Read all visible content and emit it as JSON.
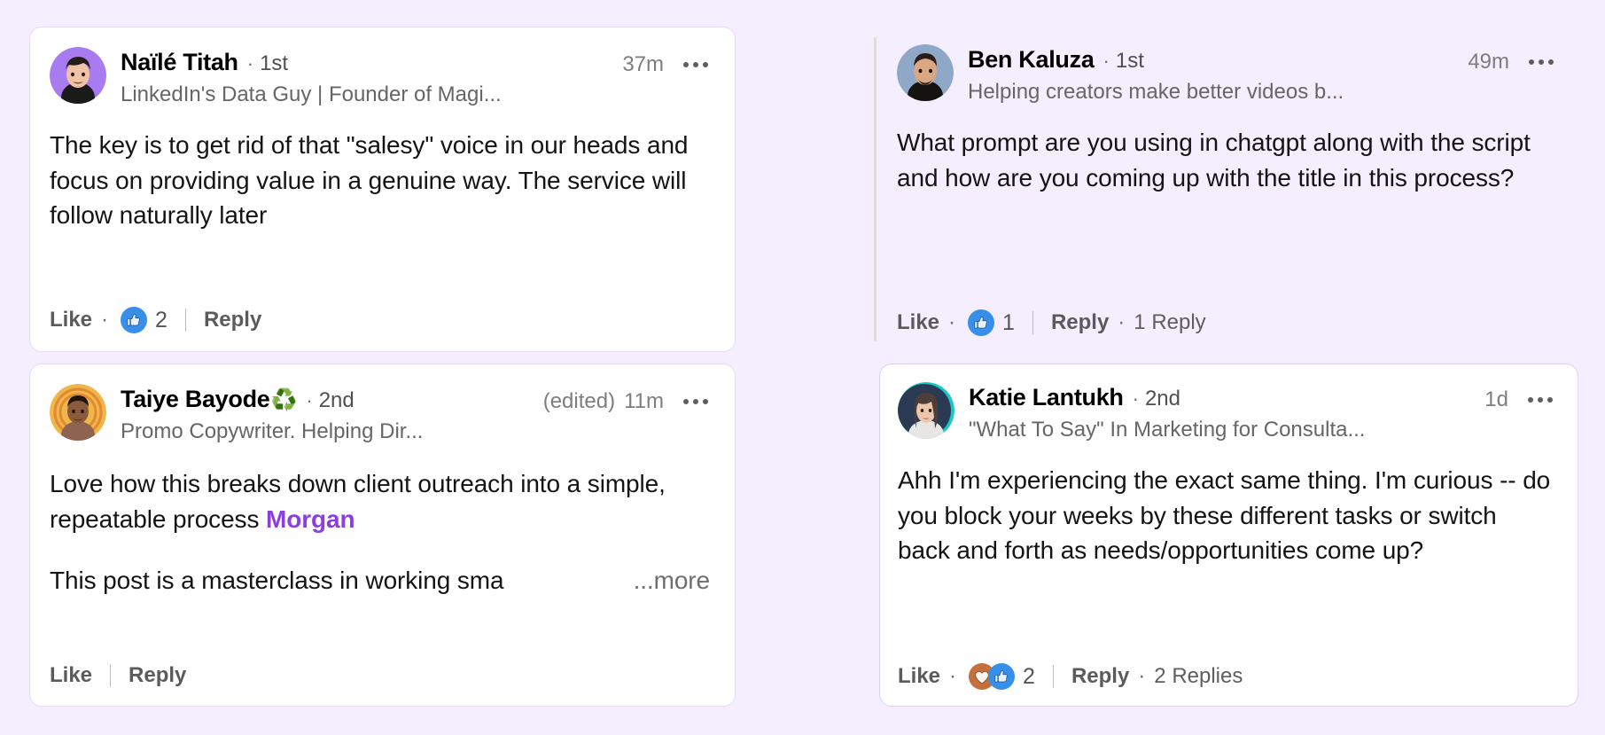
{
  "page": {
    "background_color": "#f4eefe",
    "card_background": "#ffffff",
    "card_border_color": "#e2d7f6",
    "mention_color": "#8b3fe0",
    "text_color": "#141414",
    "muted_text_color": "#6b6b6b"
  },
  "labels": {
    "like": "Like",
    "reply": "Reply",
    "more": "...more",
    "edited": "(edited)",
    "separator_dot": "·",
    "ellipsis_menu": "more-options"
  },
  "comments": [
    {
      "id": "comment-naile-titah",
      "position": "top-left",
      "author": {
        "name": "Naïlé Titah",
        "badge_emoji": "",
        "degree": "1st",
        "headline": "LinkedIn's Data Guy | Founder of Magi...",
        "avatar": {
          "name": "naile-titah-avatar",
          "bg_color": "#a97bf0",
          "skin_color": "#f0c3a4",
          "hair_color": "#241c18",
          "shirt_color": "#1a1a1a"
        }
      },
      "timestamp": "37m",
      "edited": false,
      "text": "The key is to get rid of that \"salesy\" voice in our heads and focus on providing value in a genuine way. The service will follow naturally later",
      "truncated": false,
      "mention": null,
      "reactions": {
        "show": true,
        "types": [
          "like"
        ],
        "count": "2"
      },
      "reply_count": "",
      "has_thread_rail": false,
      "has_card_border": true
    },
    {
      "id": "comment-ben-kaluza",
      "position": "top-right",
      "author": {
        "name": "Ben Kaluza",
        "badge_emoji": "",
        "degree": "1st",
        "headline": "Helping creators make better videos b...",
        "avatar": {
          "name": "ben-kaluza-avatar",
          "bg_color": "#8fa8c8",
          "skin_color": "#d9a882",
          "hair_color": "#2a1d16",
          "shirt_color": "#15130f"
        }
      },
      "timestamp": "49m",
      "edited": false,
      "text": "What prompt are you using in chatgpt along with the script and how are you coming up with the title in this process?",
      "truncated": false,
      "mention": null,
      "reactions": {
        "show": true,
        "types": [
          "like"
        ],
        "count": "1"
      },
      "reply_count": "1 Reply",
      "has_thread_rail": true,
      "has_card_border": false
    },
    {
      "id": "comment-taiye-bayode",
      "position": "bottom-left",
      "author": {
        "name": "Taiye Bayode",
        "badge_emoji": "♻️",
        "degree": "2nd",
        "headline": "Promo Copywriter. Helping Dir...",
        "avatar": {
          "name": "taiye-bayode-avatar",
          "bg_color": "#f0b64a",
          "skin_color": "#8a5a3c",
          "hair_color": "#1e1512",
          "shirt_color": "#8d6352"
        }
      },
      "timestamp": "11m",
      "edited": true,
      "text_lines": [
        "Love how this breaks down client outreach into a simple, repeatable process ",
        "This post is a masterclass in working sma"
      ],
      "mention": "Morgan",
      "truncated": true,
      "reactions": {
        "show": false,
        "types": [],
        "count": ""
      },
      "reply_count": "",
      "has_thread_rail": false,
      "has_card_border": true
    },
    {
      "id": "comment-katie-lantukh",
      "position": "bottom-right",
      "author": {
        "name": "Katie Lantukh",
        "badge_emoji": "",
        "degree": "2nd",
        "headline": "\"What To Say\" In Marketing for Consulta...",
        "avatar": {
          "name": "katie-lantukh-avatar",
          "bg_color": "#2a3a52",
          "ring_color": "#18c7c7",
          "skin_color": "#edc6ab",
          "hair_color": "#4c3f3a",
          "shirt_color": "#e8e6e3"
        }
      },
      "timestamp": "1d",
      "edited": false,
      "text": "Ahh I'm experiencing the exact same thing. I'm curious -- do you block your weeks by these different tasks or switch back and forth as needs/opportunities come up?",
      "truncated": false,
      "mention": null,
      "reactions": {
        "show": true,
        "types": [
          "love",
          "like"
        ],
        "count": "2"
      },
      "reply_count": "2 Replies",
      "has_thread_rail": true,
      "has_card_border": true
    }
  ]
}
